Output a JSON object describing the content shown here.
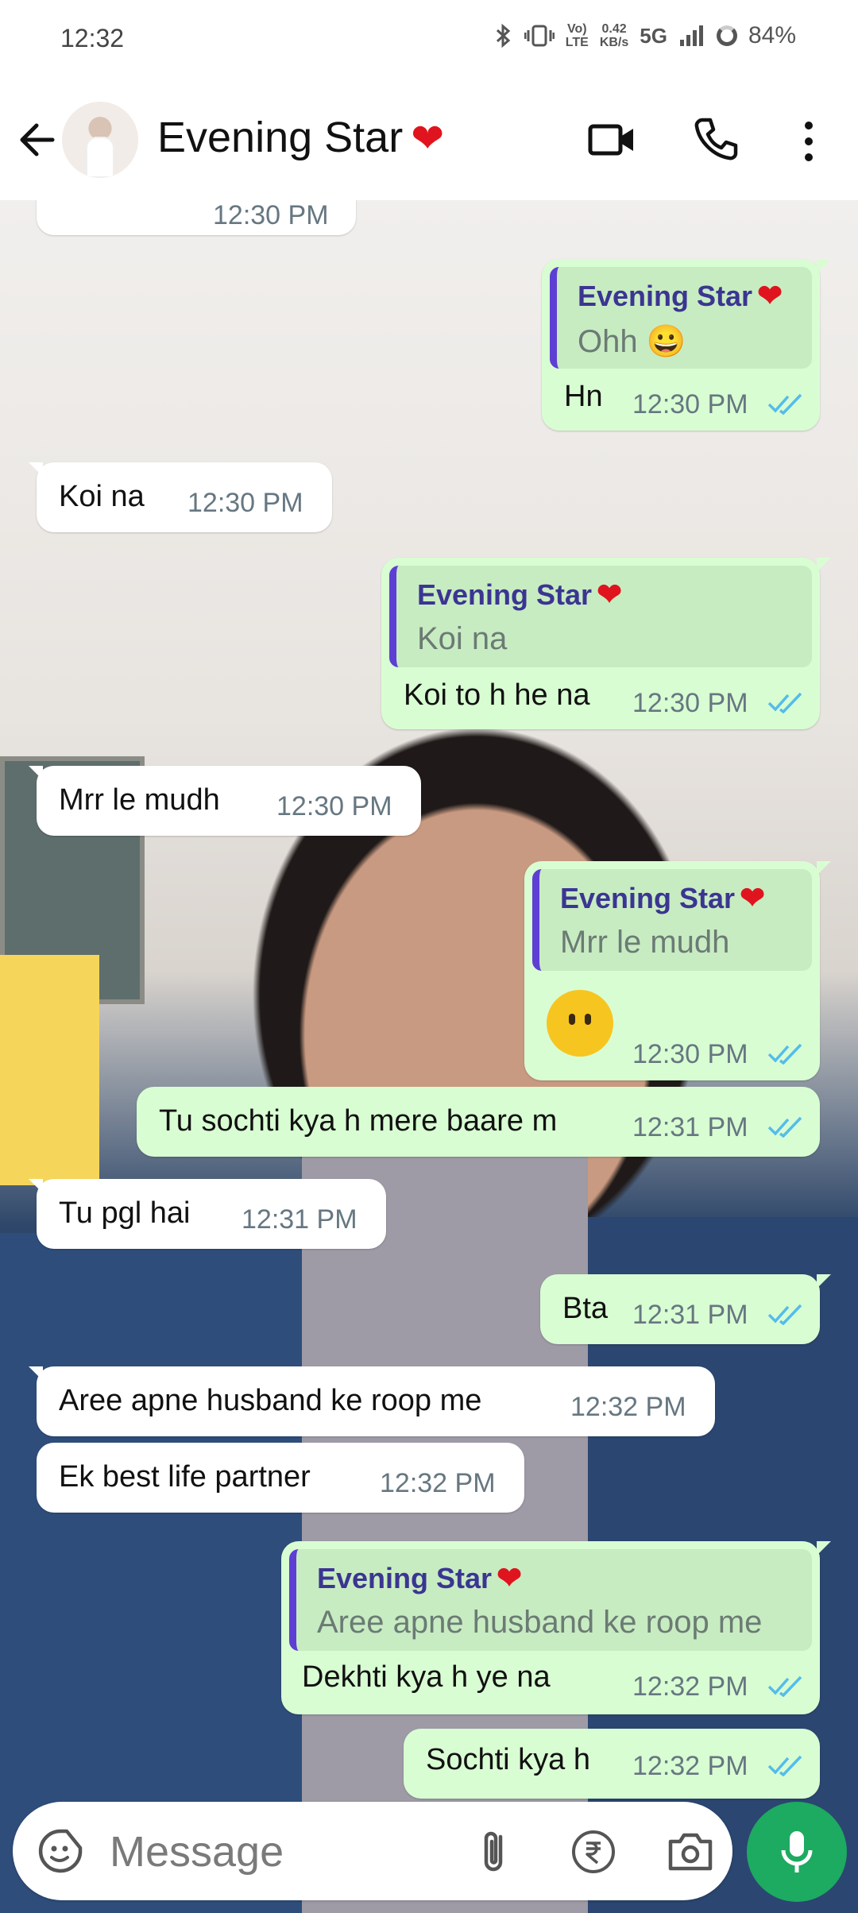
{
  "status_bar": {
    "time": "12:32",
    "network_speed_value": "0.42",
    "network_speed_unit": "KB/s",
    "volte_top": "Vo)",
    "volte_bottom": "LTE",
    "network_type": "5G",
    "battery": "84%"
  },
  "header": {
    "contact_name": "Evening Star",
    "heart": "❤"
  },
  "messages": [
    {
      "dir": "in",
      "text": "",
      "time": "12:30 PM"
    },
    {
      "dir": "out",
      "quote_name": "Evening Star",
      "quote_text": "Ohh 😀",
      "text": "Hn",
      "time": "12:30 PM"
    },
    {
      "dir": "in",
      "text": "Koi na",
      "time": "12:30 PM"
    },
    {
      "dir": "out",
      "quote_name": "Evening Star",
      "quote_text": "Koi na",
      "text": "Koi to h he na",
      "time": "12:30 PM"
    },
    {
      "dir": "in",
      "text": "Mrr le mudh",
      "time": "12:30 PM"
    },
    {
      "dir": "out",
      "quote_name": "Evening Star",
      "quote_text": "Mrr le mudh",
      "text": "",
      "emoji": "no-mouth-face",
      "time": "12:30 PM"
    },
    {
      "dir": "out",
      "text": "Tu sochti kya h mere baare m",
      "time": "12:31 PM"
    },
    {
      "dir": "in",
      "text": "Tu pgl hai",
      "time": "12:31 PM"
    },
    {
      "dir": "out",
      "text": "Bta",
      "time": "12:31 PM"
    },
    {
      "dir": "in",
      "text": "Aree apne husband ke roop me",
      "time": "12:32 PM"
    },
    {
      "dir": "in",
      "text": "Ek best life partner",
      "time": "12:32 PM"
    },
    {
      "dir": "out",
      "quote_name": "Evening Star",
      "quote_text": "Aree apne husband ke roop me",
      "text": "Dekhti kya h ye na",
      "time": "12:32 PM"
    },
    {
      "dir": "out",
      "text": "Sochti kya h",
      "time": "12:32 PM"
    }
  ],
  "input": {
    "placeholder": "Message"
  },
  "colors": {
    "outgoing_bubble": "#d9fdd3",
    "incoming_bubble": "#ffffff",
    "read_ticks": "#53bdeb",
    "mic_button": "#1daa61",
    "quote_bar": "#5e3fd3"
  }
}
